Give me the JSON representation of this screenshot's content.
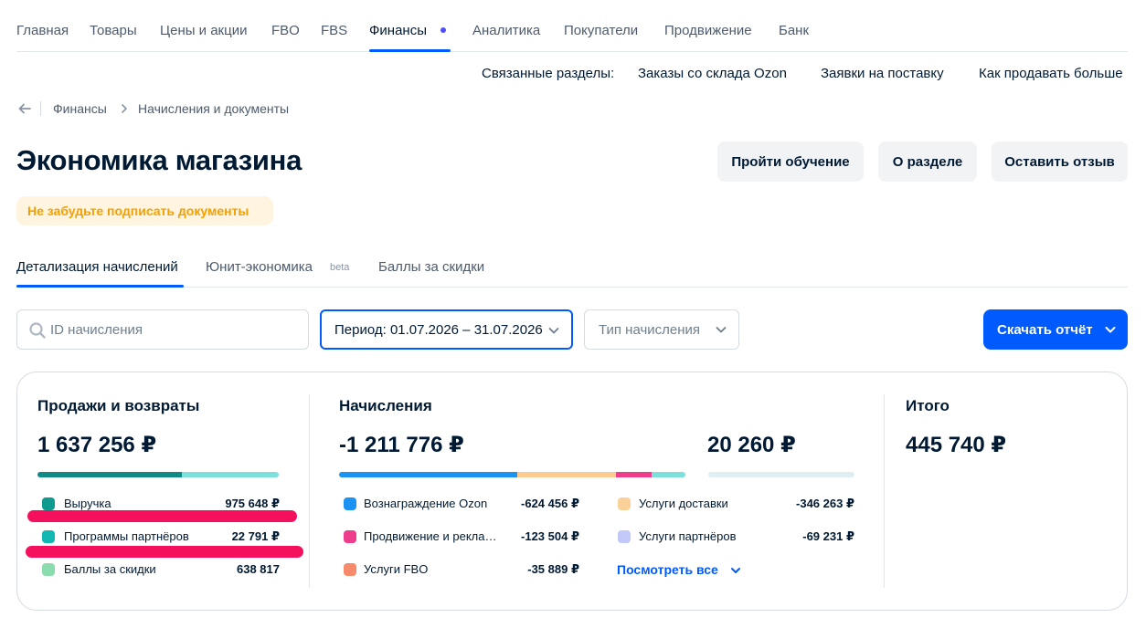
{
  "nav": {
    "items": [
      "Главная",
      "Товары",
      "Цены и акции",
      "FBO",
      "FBS",
      "Финансы",
      "Аналитика",
      "Покупатели",
      "Продвижение",
      "Банк"
    ],
    "active": "Финансы"
  },
  "related": {
    "label": "Связанные разделы:",
    "links": [
      "Заказы со склада Ozon",
      "Заявки на поставку",
      "Как продавать больше"
    ]
  },
  "breadcrumb": {
    "items": [
      "Финансы",
      "Начисления и документы"
    ]
  },
  "page": {
    "title": "Экономика магазина",
    "buttons": [
      "Пройти обучение",
      "О разделе",
      "Оставить отзыв"
    ],
    "warning": "Не забудьте подписать документы"
  },
  "tabs": {
    "items": [
      "Детализация начислений",
      "Юнит-экономика",
      "Баллы за скидки"
    ],
    "beta": "beta",
    "active": "Детализация начислений"
  },
  "filters": {
    "search_placeholder": "ID начисления",
    "period": "Период: 01.07.2026 – 31.07.2026",
    "type": "Тип начисления",
    "download": "Скачать отчёт"
  },
  "summary": {
    "sales": {
      "title": "Продажи и возвраты",
      "total": "1 637 256 ₽",
      "items": [
        {
          "label": "Выручка",
          "value": "975 648 ₽",
          "color": "#0f9a8f"
        },
        {
          "label": "Программы партнёров",
          "value": "22 791 ₽",
          "color": "#14b8b3"
        },
        {
          "label": "Баллы за скидки",
          "value": "638 817",
          "color": "#8bdcae"
        }
      ],
      "bar": [
        {
          "share": 0.6,
          "color": "#0f8a86"
        },
        {
          "share": 0.4,
          "color": "#7de0db"
        }
      ]
    },
    "charges": {
      "title": "Начисления",
      "total": "-1 211 776 ₽",
      "secondary_total": "20 260 ₽",
      "items": [
        {
          "label": "Вознаграждение Ozon",
          "value": "-624 456 ₽",
          "color": "#1a93f2"
        },
        {
          "label": "Продвижение и рекла…",
          "value": "-123 504 ₽",
          "color": "#ee3d8a"
        },
        {
          "label": "Услуги FBO",
          "value": "-35 889 ₽",
          "color": "#f88a6c"
        },
        {
          "label": "Услуги доставки",
          "value": "-346 263 ₽",
          "color": "#fbd19a"
        },
        {
          "label": "Услуги партнёров",
          "value": "-69 231 ₽",
          "color": "#c2c8f7"
        }
      ],
      "bar": [
        {
          "share": 0.515,
          "color": "#1a93f2"
        },
        {
          "share": 0.285,
          "color": "#fbcb8f"
        },
        {
          "share": 0.102,
          "color": "#ee3d8a"
        },
        {
          "share": 0.098,
          "color": "#7de0db"
        }
      ],
      "secondary_bar_color": "#dfeef2",
      "see_all": "Посмотреть все"
    },
    "total": {
      "title": "Итого",
      "value": "445 740 ₽"
    }
  }
}
